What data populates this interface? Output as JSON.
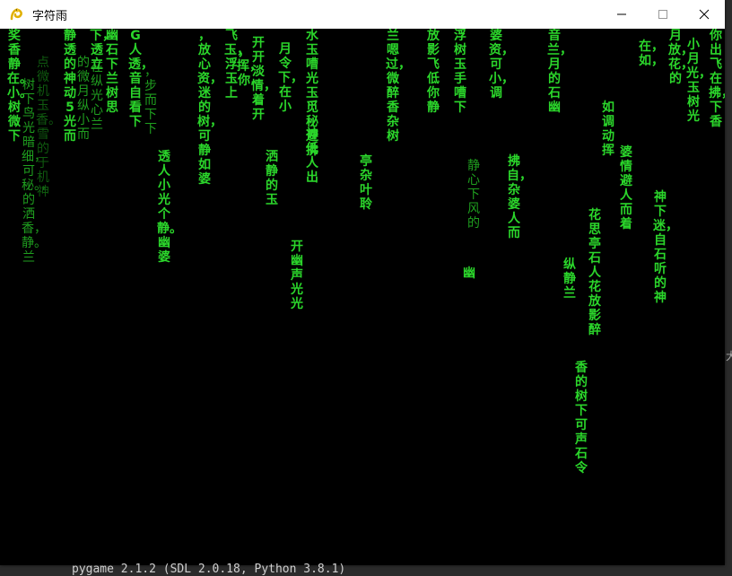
{
  "window": {
    "title": "字符雨",
    "icon": "pygame-snake-icon",
    "minimize_icon": "minimize-icon",
    "maximize_icon": "maximize-icon",
    "close_icon": "close-icon"
  },
  "colors": {
    "background": "#000000",
    "rain_bright": "#2bd62b",
    "rain_mid": "#1f9f1f",
    "rain_dim": "#0f5a0f"
  },
  "rain": {
    "columns": [
      {
        "text": "奖香静在。小。树微下",
        "tone": "bright"
      },
      {
        "text": "树下鸟光暗细，可秘。，的洒香，静。兰",
        "tone": "mid"
      },
      {
        "text": "点微机玉香。雪的于机神",
        "tone": "dim"
      },
      {
        "text": "静透的神动5光而",
        "tone": "bright"
      },
      {
        "text": "的微月纵小而",
        "tone": "mid"
      },
      {
        "text": "在纵光心兰",
        "tone": "mid"
      },
      {
        "text": "下，透立",
        "tone": "bright"
      },
      {
        "text": "幽石下兰树思",
        "tone": "bright"
      },
      {
        "text": "G人透，音自看下",
        "tone": "bright"
      },
      {
        "text": "，步而下下",
        "tone": "mid"
      },
      {
        "text": "透人小光个静。幽婆",
        "tone": "bright"
      },
      {
        "text": "，放心资，迷的树，可静如婆",
        "tone": "bright"
      },
      {
        "text": "飞玉，浮玉上",
        "tone": "bright"
      },
      {
        "text": "，挥，你",
        "tone": "bright"
      },
      {
        "text": "开开淡情，着开",
        "tone": "bright"
      },
      {
        "text": "月令下，在小",
        "tone": "bright"
      },
      {
        "text": "洒静的玉",
        "tone": "bright"
      },
      {
        "text": "水玉嘈光玉觅秘避拂",
        "tone": "bright"
      },
      {
        "text": "神低人出",
        "tone": "bright"
      },
      {
        "text": "开幽声光光",
        "tone": "bright"
      },
      {
        "text": "亭杂叶聆",
        "tone": "bright"
      },
      {
        "text": "兰嗯过，微醉香杂树",
        "tone": "bright"
      },
      {
        "text": "放影飞低你静",
        "tone": "bright"
      },
      {
        "text": "浮树玉手嘈下",
        "tone": "bright"
      },
      {
        "text": "静心下风的",
        "tone": "mid"
      },
      {
        "text": "婆资，可小，调",
        "tone": "bright"
      },
      {
        "text": "幽",
        "tone": "bright"
      },
      {
        "text": "拂自，杂婆人而",
        "tone": "bright"
      },
      {
        "text": "音兰，月的石幽",
        "tone": "bright"
      },
      {
        "text": "纵静兰",
        "tone": "bright"
      },
      {
        "text": "花思亭石人花放影醉",
        "tone": "bright"
      },
      {
        "text": "香的树下可声石令",
        "tone": "bright"
      },
      {
        "text": "如调动挥",
        "tone": "bright"
      },
      {
        "text": "在，如，",
        "tone": "bright"
      },
      {
        "text": "婆情避人而着",
        "tone": "bright"
      },
      {
        "text": "神下迷，自石听的神",
        "tone": "bright"
      },
      {
        "text": "小月光，玉树光",
        "tone": "bright"
      },
      {
        "text": "月放，花，的",
        "tone": "bright"
      },
      {
        "text": "你出飞在拂，下香",
        "tone": "bright"
      }
    ]
  },
  "status": {
    "terminal_line": "pygame 2.1.2 (SDL 2.0.18, Python 3.8.1)",
    "side_fragment": "大"
  }
}
